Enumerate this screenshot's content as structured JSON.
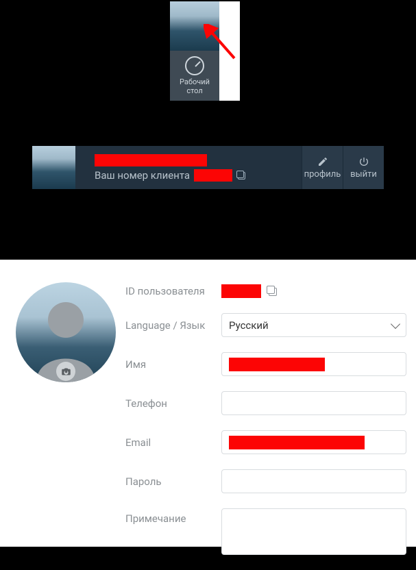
{
  "top": {
    "dashboard_label_line1": "Рабочий",
    "dashboard_label_line2": "стол"
  },
  "header": {
    "client_label": "Ваш номер клиента",
    "profile_btn": "профиль",
    "logout_btn": "выйти"
  },
  "profile": {
    "labels": {
      "user_id": "ID пользователя",
      "language": "Language / Язык",
      "name": "Имя",
      "phone": "Телефон",
      "email": "Email",
      "password": "Пароль",
      "note": "Примечание"
    },
    "language_value": "Русский",
    "phone_value": "",
    "password_value": "",
    "note_value": ""
  }
}
